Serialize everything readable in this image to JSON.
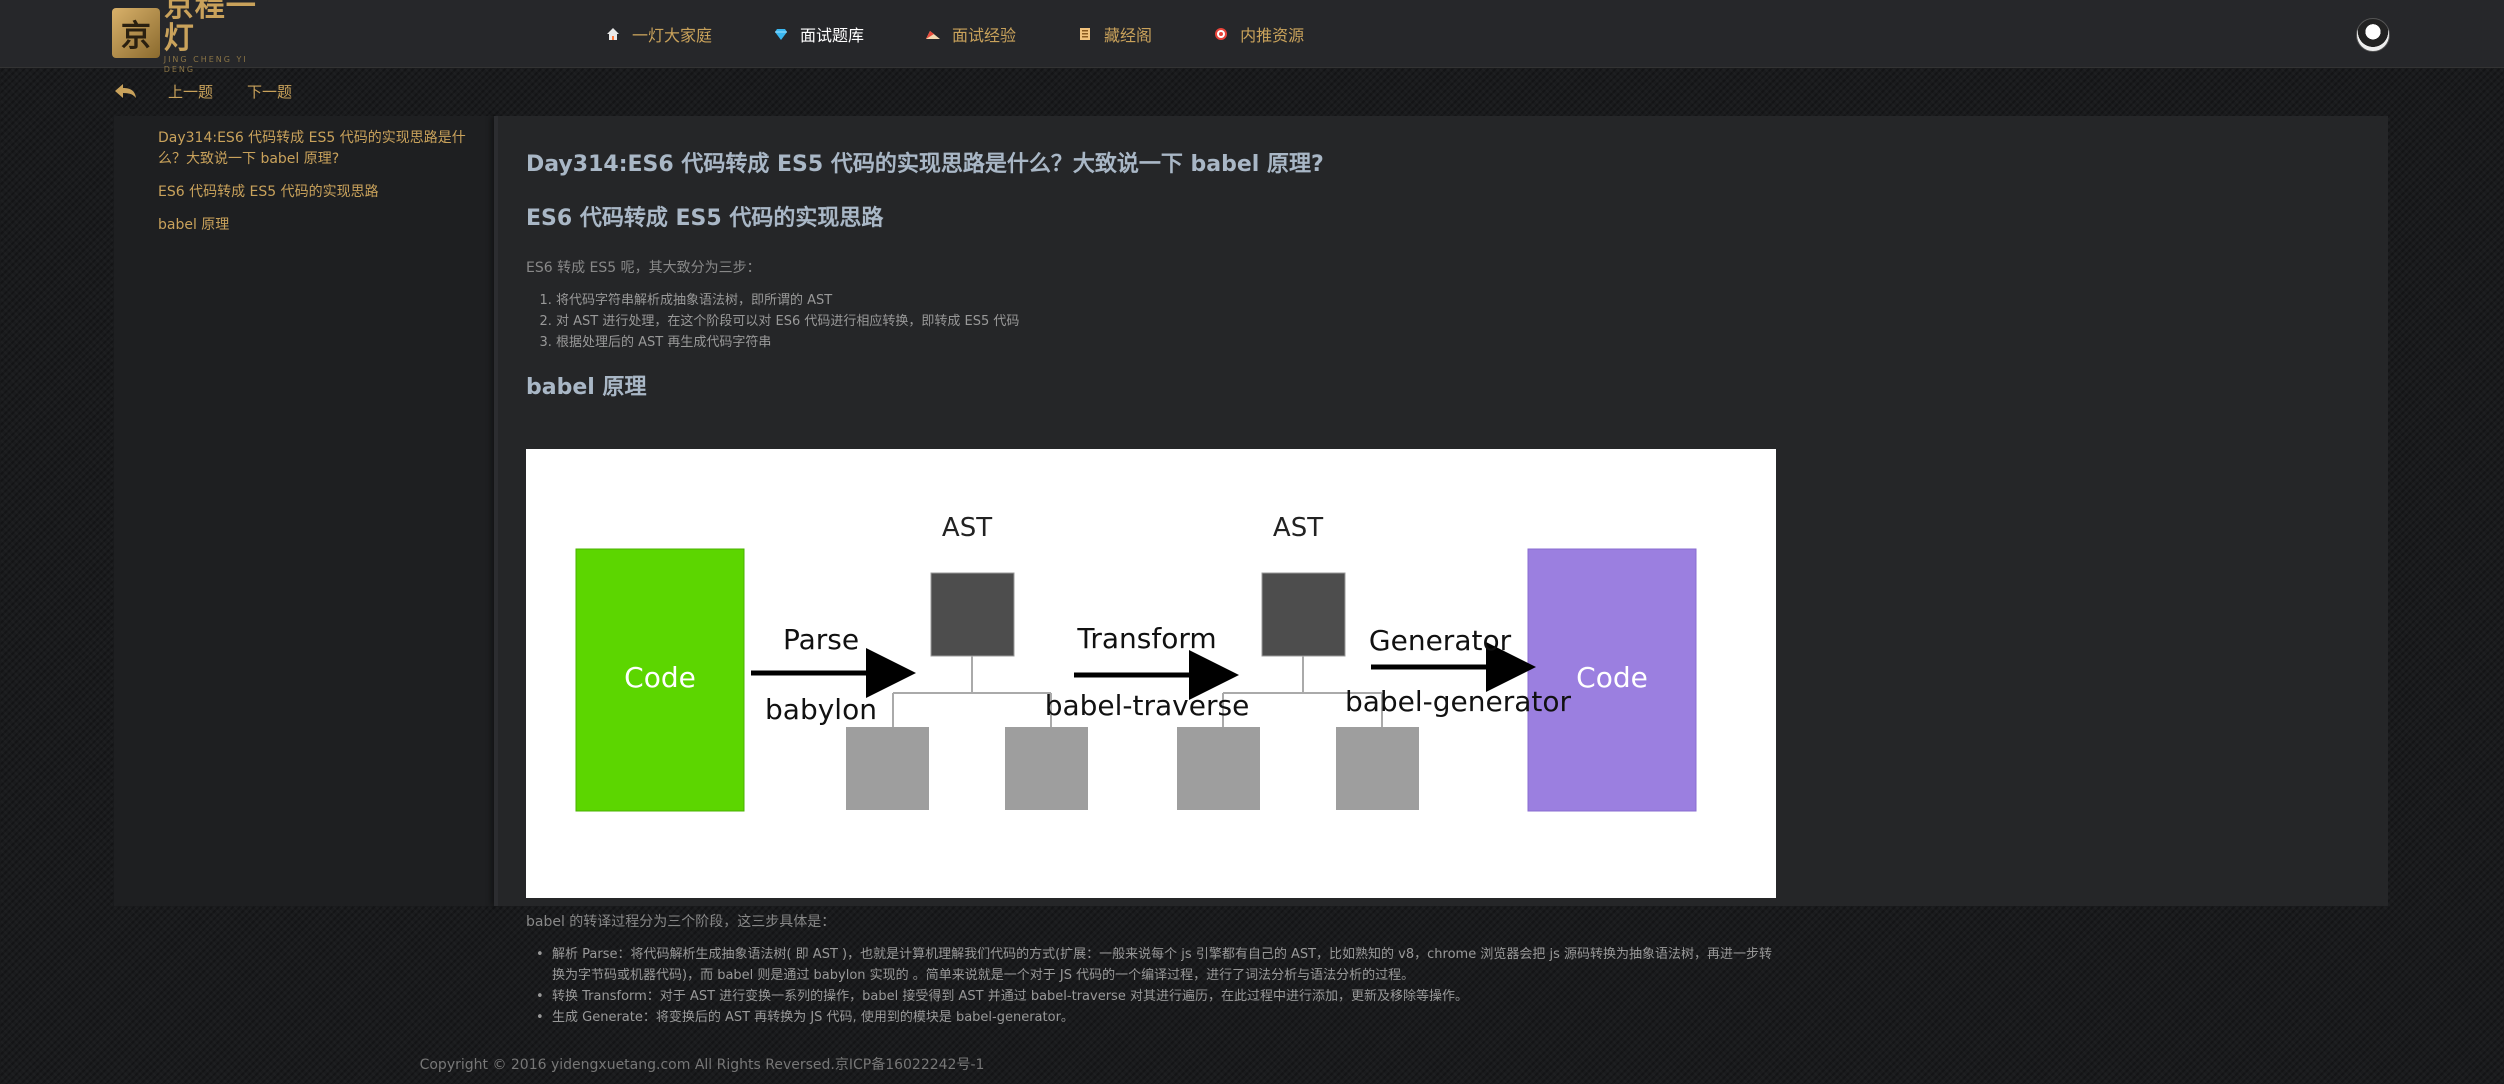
{
  "brand": {
    "name": "京程一灯",
    "sub": "JING CHENG YI DENG"
  },
  "nav": [
    {
      "label": "一灯大家庭",
      "icon": "home-icon",
      "active": false
    },
    {
      "label": "面试题库",
      "icon": "diamond-icon",
      "active": true
    },
    {
      "label": "面试经验",
      "icon": "cake-icon",
      "active": false
    },
    {
      "label": "藏经阁",
      "icon": "book-icon",
      "active": false
    },
    {
      "label": "内推资源",
      "icon": "target-icon",
      "active": false
    }
  ],
  "subnav": {
    "prev": "上一题",
    "next": "下一题"
  },
  "toc": [
    "Day314:ES6 代码转成 ES5 代码的实现思路是什么？大致说一下 babel 原理?",
    "ES6 代码转成 ES5 代码的实现思路",
    "babel 原理"
  ],
  "article": {
    "title": "Day314:ES6 代码转成 ES5 代码的实现思路是什么？大致说一下 babel 原理?",
    "section1": "ES6 代码转成 ES5 代码的实现思路",
    "intro": "ES6 转成 ES5 呢，其大致分为三步：",
    "steps": [
      "将代码字符串解析成抽象语法树，即所谓的 AST",
      "对 AST 进行处理，在这个阶段可以对 ES6 代码进行相应转换，即转成 ES5 代码",
      "根据处理后的 AST 再生成代码字符串"
    ],
    "section2": "babel 原理",
    "diagram": {
      "code_left": "Code",
      "code_right": "Code",
      "ast1": "AST",
      "ast2": "AST",
      "parse": "Parse",
      "babylon": "babylon",
      "transform": "Transform",
      "traverse": "babel-traverse",
      "generator": "Generator",
      "babel_generator": "babel-generator",
      "colors": {
        "left": "#5cd600",
        "right": "#9b7fe0",
        "node_dark": "#4d4d4d",
        "node_light": "#9e9e9e"
      }
    },
    "lower_intro": "babel 的转译过程分为三个阶段，这三步具体是：",
    "bullets": [
      "解析 Parse：将代码解析生成抽象语法树( 即 AST )，也就是计算机理解我们代码的方式(扩展：一般来说每个 js 引擎都有自己的 AST，比如熟知的 v8，chrome 浏览器会把 js 源码转换为抽象语法树，再进一步转换为字节码或机器代码)，而 babel 则是通过 babylon 实现的 。简单来说就是一个对于 JS 代码的一个编译过程，进行了词法分析与语法分析的过程。",
      "转换 Transform：对于 AST 进行变换一系列的操作，babel 接受得到 AST 并通过 babel-traverse 对其进行遍历，在此过程中进行添加，更新及移除等操作。",
      "生成 Generate：将变换后的 AST 再转换为 JS 代码, 使用到的模块是 babel-generator。"
    ]
  },
  "footer": "Copyright © 2016 yidengxuetang.com All Rights Reversed.京ICP备16022242号-1"
}
